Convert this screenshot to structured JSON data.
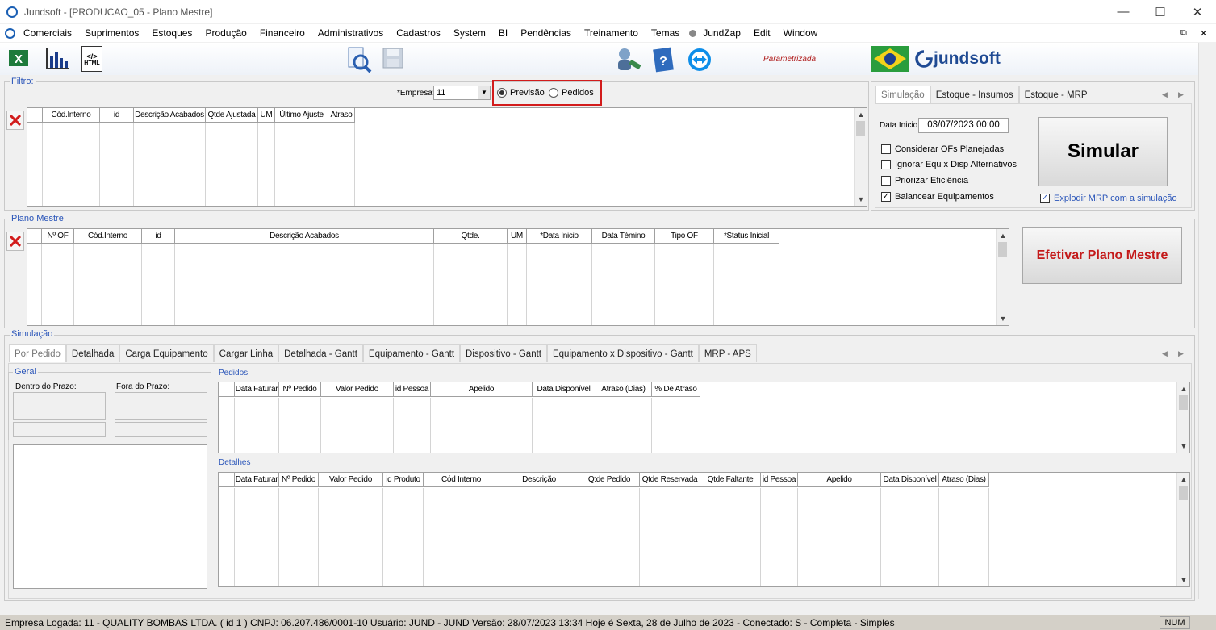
{
  "window": {
    "title": "Jundsoft - [PRODUCAO_05 - Plano Mestre]",
    "minimize": "—",
    "maximize": "☐",
    "close": "✕",
    "mdi_restore": "⧉",
    "mdi_close": "✕"
  },
  "menu": [
    "Comerciais",
    "Suprimentos",
    "Estoques",
    "Produção",
    "Financeiro",
    "Administrativos",
    "Cadastros",
    "System",
    "BI",
    "Pendências",
    "Treinamento",
    "Temas",
    "JundZap",
    "Edit",
    "Window"
  ],
  "toolbar": {
    "parametrizada": "Parametrizada",
    "brand": "jundsoft",
    "html_label": "HTML"
  },
  "filtro": {
    "legend": "Filtro:",
    "empresa_label": "*Empresa:",
    "empresa_value": "11",
    "radio_previsao": "Previsão",
    "radio_pedidos": "Pedidos",
    "columns": [
      "Cód.Interno",
      "id",
      "Descrição Acabados",
      "Qtde Ajustada",
      "UM",
      "Último Ajuste",
      "Atraso"
    ]
  },
  "right_panel": {
    "tabs": [
      "Simulação",
      "Estoque - Insumos",
      "Estoque - MRP"
    ],
    "data_inicio_label": "Data Inicio:",
    "data_inicio_value": "03/07/2023 00:00",
    "checks": [
      {
        "label": "Considerar OFs Planejadas",
        "checked": false
      },
      {
        "label": "Ignorar Equ x Disp Alternativos",
        "checked": false
      },
      {
        "label": "Priorizar Eficiência",
        "checked": false
      },
      {
        "label": "Balancear Equipamentos",
        "checked": true
      }
    ],
    "simular": "Simular",
    "explodir": "Explodir MRP com a simulação",
    "explodir_checked": true
  },
  "plano": {
    "legend": "Plano Mestre",
    "columns": [
      "Nº OF",
      "Cód.Interno",
      "id",
      "Descrição Acabados",
      "Qtde.",
      "UM",
      "*Data Inicio",
      "Data Témino",
      "Tipo OF",
      "*Status Inicial"
    ],
    "efetivar": "Efetivar Plano Mestre"
  },
  "simulacao": {
    "legend": "Simulação",
    "tabs": [
      "Por Pedido",
      "Detalhada",
      "Carga Equipamento",
      "Cargar Linha",
      "Detalhada - Gantt",
      "Equipamento - Gantt",
      "Dispositivo - Gantt",
      "Equipamento x Dispositivo - Gantt",
      "MRP - APS"
    ],
    "geral_legend": "Geral",
    "dentro": "Dentro do Prazo:",
    "fora": "Fora do Prazo:",
    "pedidos_legend": "Pedidos",
    "pedidos_columns": [
      "Data Faturar",
      "Nº Pedido",
      "Valor Pedido",
      "id Pessoa",
      "Apelido",
      "Data Disponível",
      "Atraso (Dias)",
      "% De Atraso"
    ],
    "detalhes_legend": "Detalhes",
    "detalhes_columns": [
      "Data Faturar",
      "Nº Pedido",
      "Valor Pedido",
      "id Produto",
      "Cód Interno",
      "Descrição",
      "Qtde Pedido",
      "Qtde Reservada",
      "Qtde Faltante",
      "id Pessoa",
      "Apelido",
      "Data Disponível",
      "Atraso (Dias)"
    ]
  },
  "status": {
    "text": "Empresa Logada: 11 - QUALITY BOMBAS LTDA. ( id 1 ) CNPJ: 06.207.486/0001-10   Usuário: JUND - JUND    Versão: 28/07/2023 13:34    Hoje é Sexta, 28 de Julho de 2023 - Conectado: S - Completa - Simples",
    "num": "NUM"
  }
}
